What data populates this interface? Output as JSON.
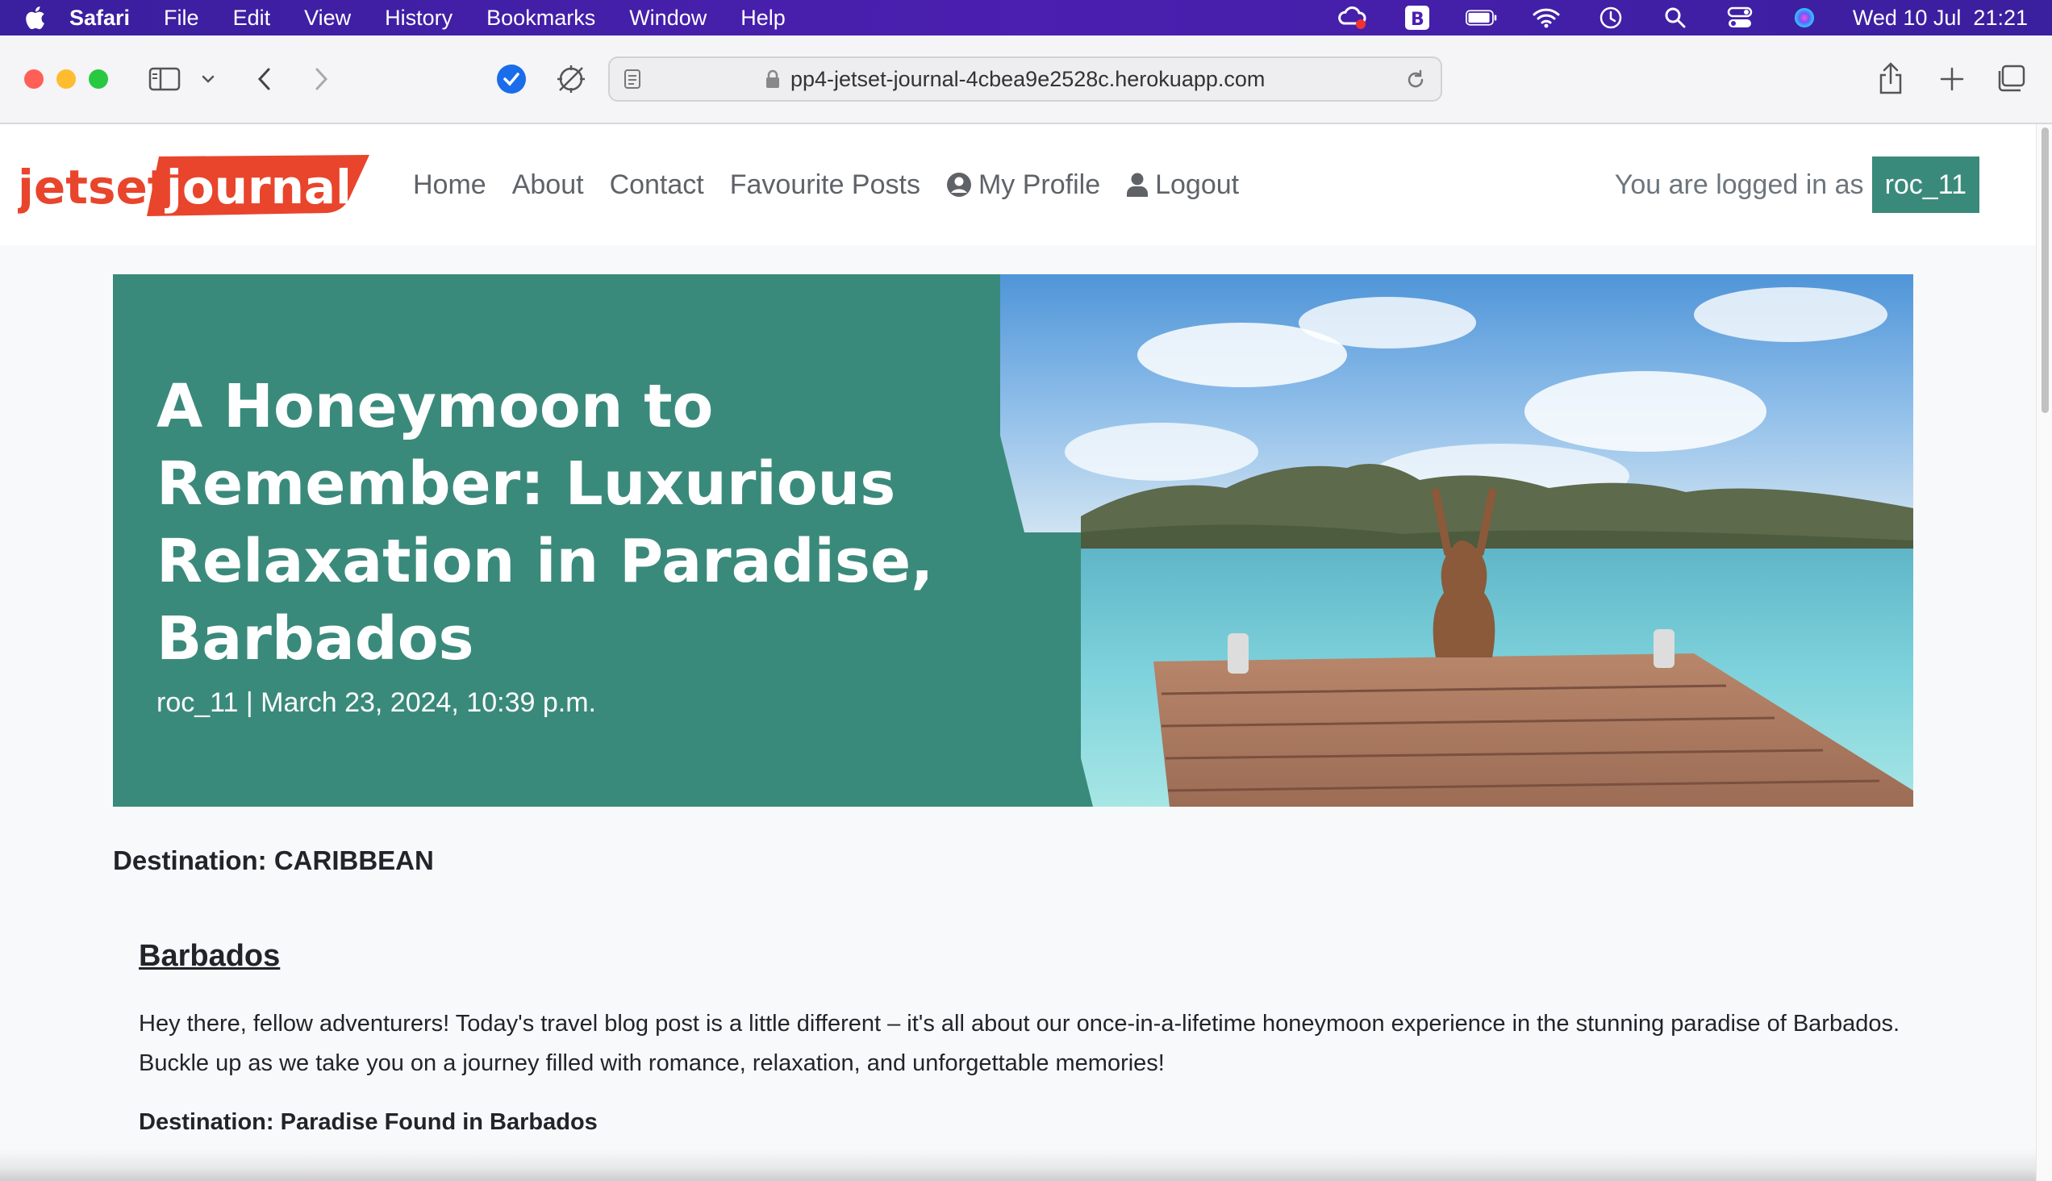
{
  "menubar": {
    "app_name": "Safari",
    "items": [
      "File",
      "Edit",
      "View",
      "History",
      "Bookmarks",
      "Window",
      "Help"
    ],
    "clock": "Wed 10 Jul  21:21",
    "icons": [
      "creative-cloud-icon",
      "bear-icon",
      "battery-icon",
      "wifi-icon",
      "time-machine-icon",
      "spotlight-icon",
      "control-center-icon",
      "siri-icon"
    ]
  },
  "browser": {
    "url": "pp4-jetset-journal-4cbea9e2528c.herokuapp.com"
  },
  "site": {
    "logo_text_1": "jetset",
    "logo_text_2": "journal",
    "nav": {
      "home": "Home",
      "about": "About",
      "contact": "Contact",
      "favourites": "Favourite Posts",
      "profile": "My Profile",
      "logout": "Logout"
    },
    "logged_in_label": "You are logged in as",
    "username": "roc_11"
  },
  "post": {
    "title": "A Honeymoon to Remember: Luxurious Relaxation in Paradise, Barbados",
    "byline": "roc_11 | March 23, 2024, 10:39 p.m.",
    "destination": "Destination: CARIBBEAN",
    "heading": "Barbados",
    "intro": "Hey there, fellow adventurers! Today's travel blog post is a little different – it's all about our once-in-a-lifetime honeymoon experience in the stunning paradise of Barbados. Buckle up as we take you on a journey filled with romance, relaxation, and unforgettable memories!",
    "subheading": "Destination: Paradise Found in Barbados"
  },
  "colors": {
    "brand_teal": "#3a8a7b",
    "logo_red": "#e8452c",
    "menubar": "#4b1fb0"
  }
}
